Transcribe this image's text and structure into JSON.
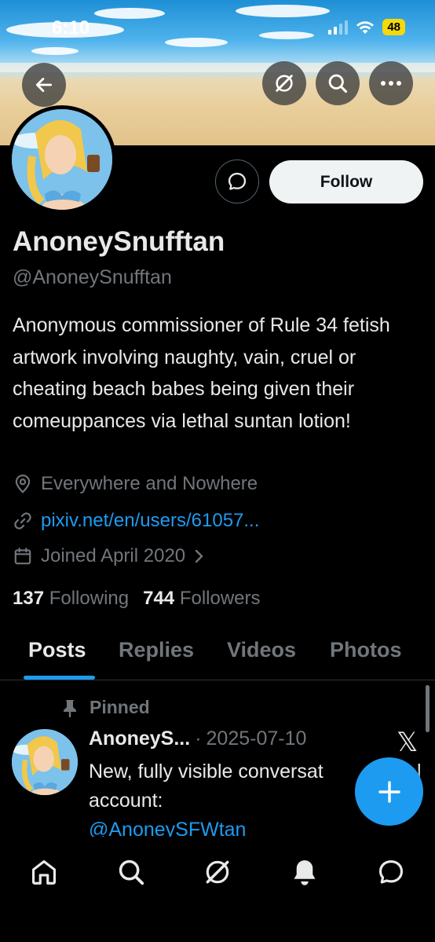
{
  "status_bar": {
    "time": "6:10",
    "battery": "48"
  },
  "profile": {
    "display_name": "AnoneySnufftan",
    "handle": "@AnoneySnufftan",
    "bio": "Anonymous commissioner of Rule 34 fetish artwork involving naughty, vain, cruel or cheating beach babes being given their comeuppances via lethal suntan lotion!",
    "location": "Everywhere and Nowhere",
    "website": "pixiv.net/en/users/61057...",
    "joined": "Joined April 2020",
    "following_count": "137",
    "following_label": "Following",
    "followers_count": "744",
    "followers_label": "Followers"
  },
  "actions": {
    "follow_label": "Follow"
  },
  "tabs": [
    {
      "label": "Posts",
      "active": true
    },
    {
      "label": "Replies",
      "active": false
    },
    {
      "label": "Videos",
      "active": false
    },
    {
      "label": "Photos",
      "active": false
    }
  ],
  "pinned_post": {
    "pinned_label": "Pinned",
    "author": "AnoneyS...",
    "separator": "·",
    "date": "2025-07-10",
    "line1": "New, fully visible conversat",
    "line1_tail": "l",
    "line2": "account:",
    "mention": "@AnoneySFWtan"
  },
  "icons": {
    "back": "back-arrow-icon",
    "grok": "grok-icon",
    "search": "search-icon",
    "more": "more-icon",
    "message": "message-icon",
    "location": "location-pin-icon",
    "link": "link-icon",
    "calendar": "calendar-icon",
    "pin": "pin-icon",
    "compose": "plus-icon",
    "home": "home-icon",
    "explore": "search-icon",
    "grok_nav": "grok-icon",
    "notifications": "bell-icon",
    "messages": "chat-bubble-icon"
  },
  "colors": {
    "accent": "#1d9bf0",
    "muted": "#71767b",
    "text": "#e7e9ea",
    "background": "#000000"
  }
}
